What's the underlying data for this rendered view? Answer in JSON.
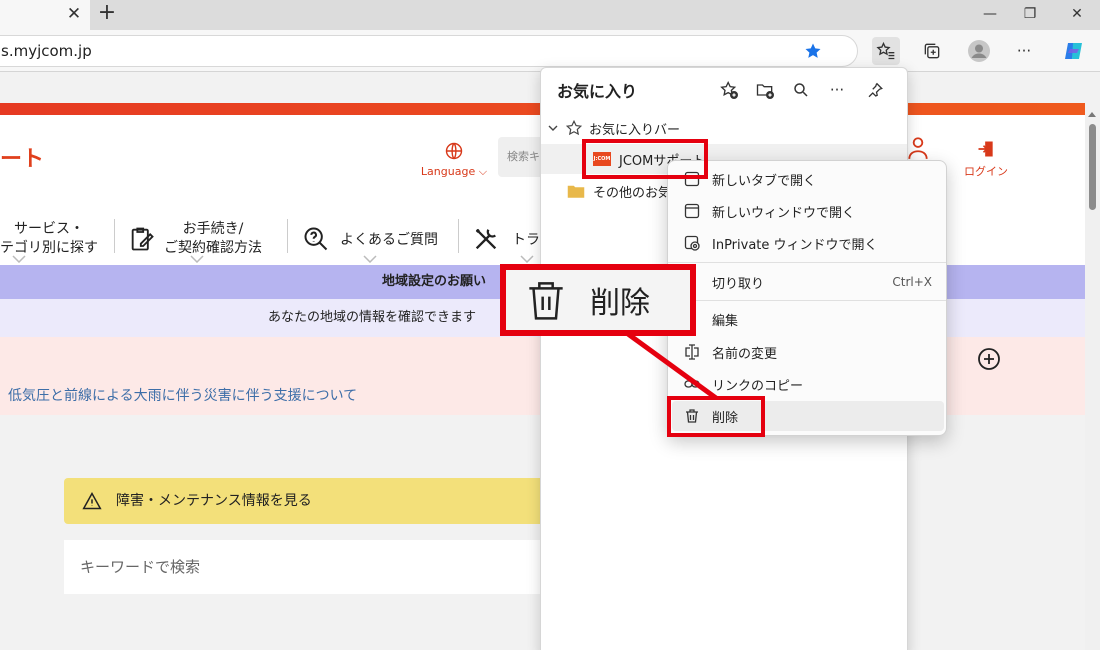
{
  "browser": {
    "tab_close": "✕",
    "new_tab": "+",
    "url": "s.myjcom.jp",
    "window": {
      "minimize": "—",
      "maximize": "❐",
      "close": "✕"
    },
    "more": "···"
  },
  "site": {
    "logo_text": "ート",
    "language_label": "Language",
    "search_placeholder": "検索キ",
    "login_label": "ログイン",
    "nav": [
      {
        "label": "サービス・\nテゴリ別に探す"
      },
      {
        "label": "お手続き/\nご契約確認方法"
      },
      {
        "label": "よくあるご質問"
      },
      {
        "label": "トラ"
      }
    ],
    "region_title": "地域設定のお願い",
    "region_sub": "あなたの地域の情報を確認できます",
    "notice_link": "低気圧と前線による大雨に伴う災害に伴う支援について",
    "maintenance": "障害・メンテナンス情報を見る",
    "keyword_search": "キーワードで検索"
  },
  "favorites": {
    "title": "お気に入り",
    "more": "···",
    "bar_folder": "お気に入りバー",
    "item": "JCOMサポート",
    "item_logo": "J:COM",
    "other_folder": "その他のお気に"
  },
  "context_menu": {
    "items": [
      {
        "label": "新しいタブで開く"
      },
      {
        "label": "新しいウィンドウで開く"
      },
      {
        "label": "InPrivate ウィンドウで開く"
      },
      {
        "label": "切り取り",
        "shortcut": "Ctrl+X"
      },
      {
        "label": "編集"
      },
      {
        "label": "名前の変更"
      },
      {
        "label": "リンクのコピー"
      },
      {
        "label": "削除"
      }
    ]
  },
  "callout": {
    "label": "削除"
  },
  "colors": {
    "accent_red": "#e5000f",
    "brand_orange": "#e0401d",
    "link_blue": "#3d6ea8"
  }
}
